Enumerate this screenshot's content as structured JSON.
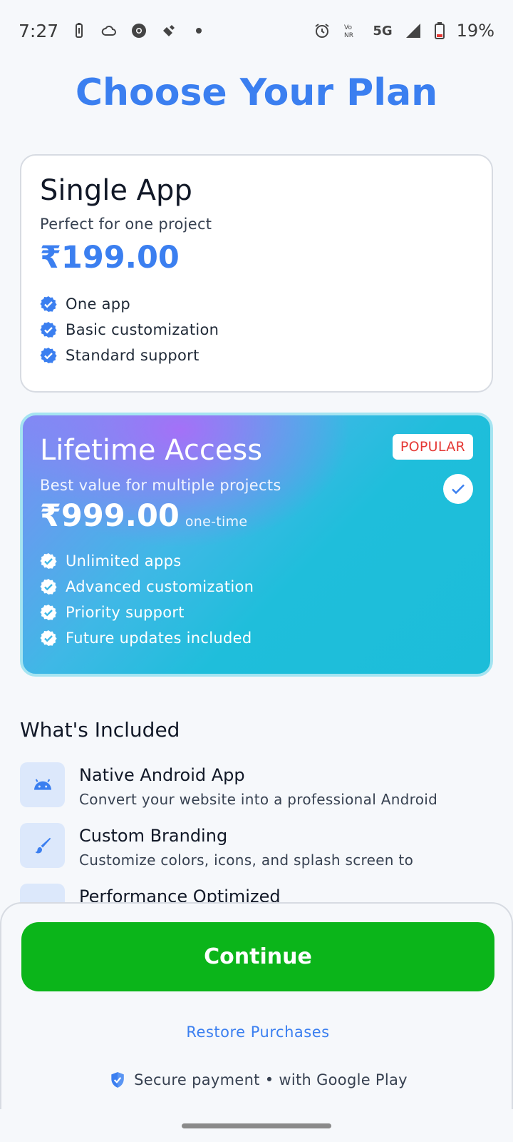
{
  "status_bar": {
    "time": "7:27",
    "battery_percent": "19%",
    "network": "5G",
    "icons": [
      "battery-saver-icon",
      "cloud-icon",
      "chrome-icon",
      "satellite-icon",
      "dot-icon",
      "alarm-icon",
      "vonr-icon",
      "signal-icon",
      "battery-icon"
    ]
  },
  "page": {
    "title": "Choose Your Plan"
  },
  "plans": [
    {
      "name": "Single App",
      "subtitle": "Perfect for one project",
      "price": "₹199.00",
      "features": [
        "One app",
        "Basic customization",
        "Standard support"
      ],
      "selected": false
    },
    {
      "name": "Lifetime Access",
      "subtitle": "Best value for multiple projects",
      "price": "₹999.00",
      "price_suffix": "one-time",
      "badge": "POPULAR",
      "features": [
        "Unlimited apps",
        "Advanced customization",
        "Priority support",
        "Future updates included"
      ],
      "selected": true
    }
  ],
  "included": {
    "title": "What's Included",
    "items": [
      {
        "icon": "android-icon",
        "title": "Native Android App",
        "description": "Convert your website into a professional Android"
      },
      {
        "icon": "brush-icon",
        "title": "Custom Branding",
        "description": "Customize colors, icons, and splash screen to"
      },
      {
        "icon": "speed-icon",
        "title": "Performance Optimized",
        "description": ""
      }
    ]
  },
  "footer": {
    "continue_label": "Continue",
    "restore_label": "Restore Purchases",
    "secure_text": "Secure payment • with Google Play"
  },
  "colors": {
    "accent": "#3b7ff0",
    "continue": "#0bb51a",
    "popular": "#e53935"
  }
}
